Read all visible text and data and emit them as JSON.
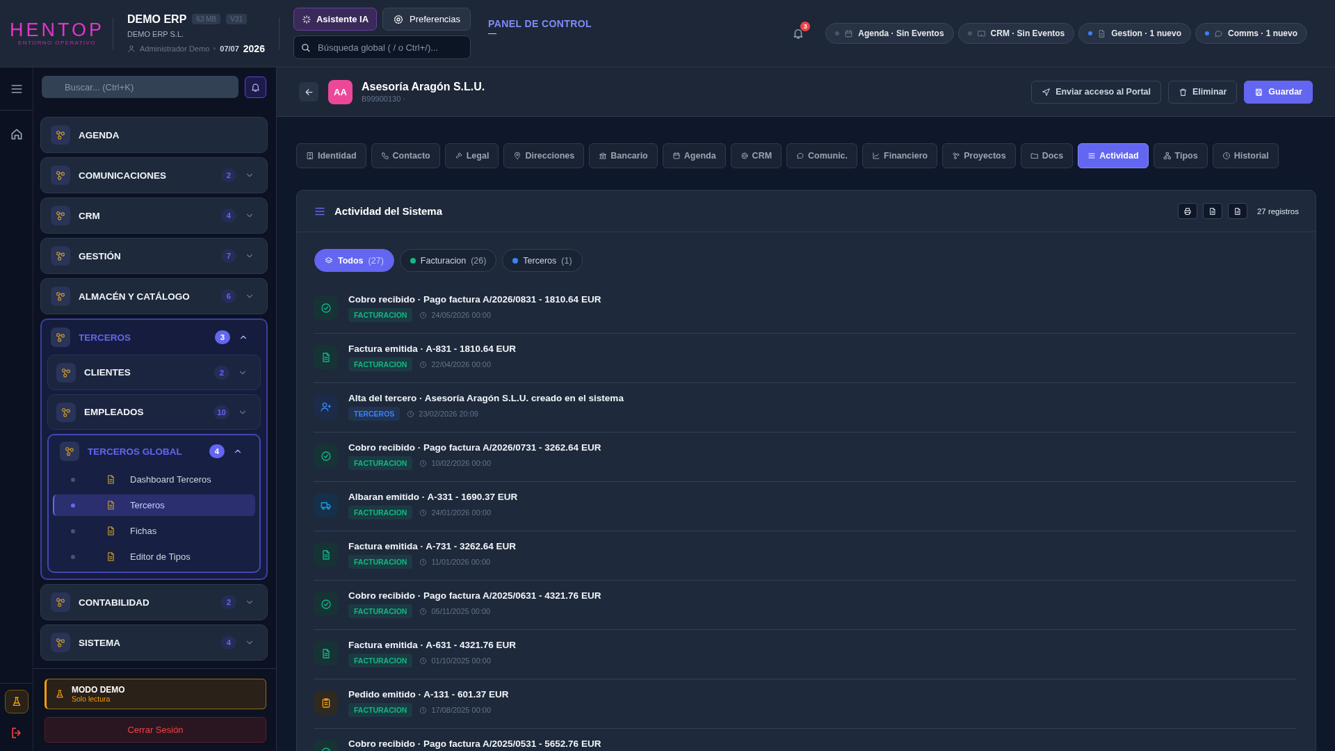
{
  "header": {
    "logo": "HENTOP",
    "logo_tagline": "ENTORNO OPERATIVO",
    "app_name": "DEMO ERP",
    "badges": [
      "63 MB",
      "V31"
    ],
    "company": "DEMO ERP S.L.",
    "user": "Administrador Demo",
    "date": "07/07",
    "year": "2026",
    "assistant_button": "Asistente IA",
    "preferences_button": "Preferencias",
    "search": {
      "placeholder": "Búsqueda global ( / o Ctrl+/)..."
    },
    "panel_link": "PANEL DE CONTROL",
    "panel_mark": "—",
    "notification_count": "3",
    "notifications": [
      {
        "label": "Agenda · Sin Eventos",
        "color": "#4b5563"
      },
      {
        "label": "CRM · Sin Eventos",
        "color": "#4b5563"
      },
      {
        "label": "Gestion · 1 nuevo",
        "color": "#3b82f6"
      },
      {
        "label": "Comms · 1 nuevo",
        "color": "#3b82f6"
      }
    ]
  },
  "sidebar": {
    "search": {
      "placeholder": "Buscar... (Ctrl+K)"
    },
    "items": [
      {
        "label": "AGENDA",
        "kind": "link"
      },
      {
        "label": "COMUNICACIONES",
        "kind": "group",
        "count": "2",
        "expanded": false
      },
      {
        "label": "CRM",
        "kind": "group",
        "count": "4",
        "expanded": false
      },
      {
        "label": "GESTIÓN",
        "kind": "group",
        "count": "7",
        "expanded": false
      },
      {
        "label": "ALMACÉN Y CATÁLOGO",
        "kind": "group",
        "count": "6",
        "expanded": false
      },
      {
        "label": "TERCEROS",
        "kind": "group",
        "count": "3",
        "expanded": true,
        "children": [
          {
            "label": "CLIENTES",
            "kind": "group",
            "count": "2",
            "expanded": false
          },
          {
            "label": "EMPLEADOS",
            "kind": "group",
            "count": "10",
            "expanded": false
          },
          {
            "label": "TERCEROS GLOBAL",
            "kind": "group",
            "count": "4",
            "expanded": true,
            "children": [
              {
                "label": "Dashboard Terceros",
                "kind": "page",
                "selected": false
              },
              {
                "label": "Terceros",
                "kind": "page",
                "selected": true
              },
              {
                "label": "Fichas",
                "kind": "page",
                "selected": false
              },
              {
                "label": "Editor de Tipos",
                "kind": "page",
                "selected": false
              }
            ]
          }
        ]
      },
      {
        "label": "CONTABILIDAD",
        "kind": "group",
        "count": "2",
        "expanded": false
      },
      {
        "label": "SISTEMA",
        "kind": "group",
        "count": "4",
        "expanded": false
      }
    ],
    "demo_notice": {
      "title": "MODO DEMO",
      "subtitle": "Solo lectura"
    },
    "logout_button": "Cerrar Sesión"
  },
  "record": {
    "initials": "AA",
    "name": "Asesoría Aragón S.L.U.",
    "subtitle": "B99900130 ·",
    "buttons": [
      {
        "label": "Enviar acceso al Portal",
        "kind": "send"
      },
      {
        "label": "Eliminar",
        "kind": "delete"
      },
      {
        "label": "Guardar",
        "kind": "save"
      }
    ]
  },
  "tabs": [
    {
      "label": "Identidad",
      "selected": false
    },
    {
      "label": "Contacto",
      "selected": false
    },
    {
      "label": "Legal",
      "selected": false
    },
    {
      "label": "Direcciones",
      "selected": false
    },
    {
      "label": "Bancario",
      "selected": false
    },
    {
      "label": "Agenda",
      "selected": false
    },
    {
      "label": "CRM",
      "selected": false
    },
    {
      "label": "Comunic.",
      "selected": false
    },
    {
      "label": "Financiero",
      "selected": false
    },
    {
      "label": "Proyectos",
      "selected": false
    },
    {
      "label": "Docs",
      "selected": false
    },
    {
      "label": "Actividad",
      "selected": true
    },
    {
      "label": "Tipos",
      "selected": false
    },
    {
      "label": "Historial",
      "selected": false
    }
  ],
  "activity": {
    "title": "Actividad del Sistema",
    "record_count": "27 registros",
    "filters": [
      {
        "label": "Todos",
        "count": "(27)",
        "selected": true
      },
      {
        "label": "Facturacion",
        "count": "(26)",
        "color": "#10b981",
        "selected": false
      },
      {
        "label": "Terceros",
        "count": "(1)",
        "color": "#3b82f6",
        "selected": false
      }
    ],
    "rows": [
      {
        "kind": "payment",
        "title": "Cobro recibido · Pago factura A/2026/0831 - 1810.64 EUR",
        "tag": {
          "label": "FACTURACION",
          "color": "#10b981"
        },
        "date": "24/05/2026 00:00"
      },
      {
        "kind": "invoice",
        "title": "Factura emitida · A-831 - 1810.64 EUR",
        "tag": {
          "label": "FACTURACION",
          "color": "#10b981"
        },
        "date": "22/04/2026 00:00"
      },
      {
        "kind": "client",
        "title": "Alta del tercero · Asesoría Aragón S.L.U. creado en el sistema",
        "tag": {
          "label": "TERCEROS",
          "color": "#3b82f6"
        },
        "date": "23/02/2026 20:09"
      },
      {
        "kind": "payment",
        "title": "Cobro recibido · Pago factura A/2026/0731 - 3262.64 EUR",
        "tag": {
          "label": "FACTURACION",
          "color": "#10b981"
        },
        "date": "10/02/2026 00:00"
      },
      {
        "kind": "delivery",
        "title": "Albaran emitido · A-331 - 1690.37 EUR",
        "tag": {
          "label": "FACTURACION",
          "color": "#10b981"
        },
        "date": "24/01/2026 00:00"
      },
      {
        "kind": "invoice",
        "title": "Factura emitida · A-731 - 3262.64 EUR",
        "tag": {
          "label": "FACTURACION",
          "color": "#10b981"
        },
        "date": "11/01/2026 00:00"
      },
      {
        "kind": "payment",
        "title": "Cobro recibido · Pago factura A/2025/0631 - 4321.76 EUR",
        "tag": {
          "label": "FACTURACION",
          "color": "#10b981"
        },
        "date": "05/11/2025 00:00"
      },
      {
        "kind": "invoice",
        "title": "Factura emitida · A-631 - 4321.76 EUR",
        "tag": {
          "label": "FACTURACION",
          "color": "#10b981"
        },
        "date": "01/10/2025 00:00"
      },
      {
        "kind": "order",
        "title": "Pedido emitido · A-131 - 601.37 EUR",
        "tag": {
          "label": "FACTURACION",
          "color": "#10b981"
        },
        "date": "17/08/2025 00:00"
      },
      {
        "kind": "payment",
        "title": "Cobro recibido · Pago factura A/2025/0531 - 5652.76 EUR"
      }
    ]
  }
}
